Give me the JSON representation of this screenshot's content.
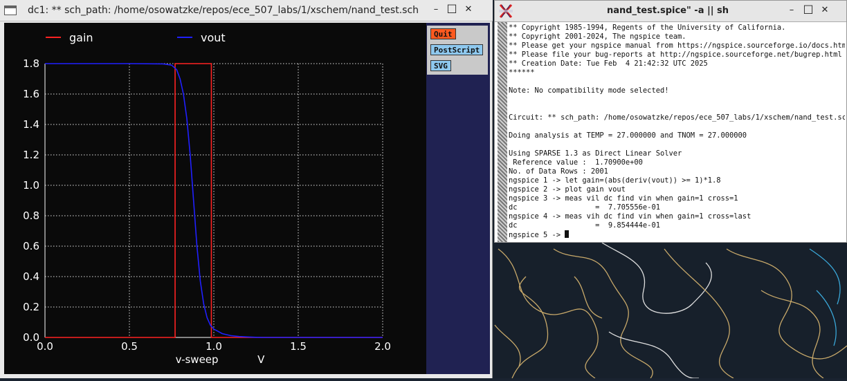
{
  "colors": {
    "gain": "#ff2222",
    "vout": "#2020ff",
    "plot_bg": "#0a0a0a",
    "grid": "#e0e0e0",
    "panel": "#202252",
    "quit": "#ff5a1f",
    "export_btn": "#8ec8ee"
  },
  "plot_window": {
    "title": "dc1: ** sch_path: /home/osowatzke/repos/ece_507_labs/1/xschem/nand_test.sch",
    "minimize_glyph": "–",
    "maximize_glyph": "□",
    "close_glyph": "✕",
    "buttons": {
      "quit": "Quit",
      "postscript": "PostScript",
      "svg": "SVG"
    }
  },
  "chart_data": {
    "type": "line",
    "xlabel": "v-sweep",
    "xunit": "V",
    "xlim": [
      0.0,
      2.0
    ],
    "ylim": [
      0.0,
      1.8
    ],
    "xticks": [
      0.0,
      0.5,
      1.0,
      1.5,
      2.0
    ],
    "xtick_labels": [
      "0.0",
      "0.5",
      "1.0",
      "1.5",
      "2.0"
    ],
    "yticks": [
      0.0,
      0.2,
      0.4,
      0.6,
      0.8,
      1.0,
      1.2,
      1.4,
      1.6,
      1.8
    ],
    "ytick_labels": [
      "0.0",
      "0.2",
      "0.4",
      "0.6",
      "0.8",
      "1.0",
      "1.2",
      "1.4",
      "1.6",
      "1.8"
    ],
    "grid": true,
    "legend_position": "top",
    "series": [
      {
        "name": "gain",
        "x": [
          0.0,
          0.7706,
          0.7706,
          0.9854,
          0.9854,
          2.0
        ],
        "values": [
          0.0,
          0.0,
          1.8,
          1.8,
          0.0,
          0.0
        ]
      },
      {
        "name": "vout",
        "x": [
          0.0,
          0.5,
          0.7,
          0.75,
          0.78,
          0.8,
          0.82,
          0.84,
          0.86,
          0.88,
          0.9,
          0.92,
          0.94,
          0.96,
          0.98,
          1.0,
          1.05,
          1.1,
          1.15,
          1.2,
          1.25,
          1.3,
          2.0
        ],
        "values": [
          1.8,
          1.8,
          1.798,
          1.79,
          1.76,
          1.7,
          1.6,
          1.44,
          1.2,
          0.9,
          0.6,
          0.37,
          0.22,
          0.13,
          0.08,
          0.055,
          0.025,
          0.012,
          0.006,
          0.003,
          0.001,
          0.0,
          0.0
        ]
      }
    ]
  },
  "terminal": {
    "title": "nand_test.spice\" -a || sh",
    "minimize_glyph": "–",
    "maximize_glyph": "□",
    "close_glyph": "✕",
    "lines": [
      "** Copyright 1985-1994, Regents of the University of California.",
      "** Copyright 2001-2024, The ngspice team.",
      "** Please get your ngspice manual from https://ngspice.sourceforge.io/docs.html",
      "** Please file your bug-reports at http://ngspice.sourceforge.net/bugrep.html",
      "** Creation Date: Tue Feb  4 21:42:32 UTC 2025",
      "******",
      "",
      "Note: No compatibility mode selected!",
      "",
      "",
      "Circuit: ** sch_path: /home/osowatzke/repos/ece_507_labs/1/xschem/nand_test.sch",
      "",
      "Doing analysis at TEMP = 27.000000 and TNOM = 27.000000",
      "",
      "Using SPARSE 1.3 as Direct Linear Solver",
      " Reference value :  1.70900e+00",
      "No. of Data Rows : 2001",
      "ngspice 1 -> let gain=(abs(deriv(vout)) >= 1)*1.8",
      "ngspice 2 -> plot gain vout",
      "ngspice 3 -> meas vil dc find vin when gain=1 cross=1",
      "dc                  =  7.705556e-01",
      "ngspice 4 -> meas vih dc find vin when gain=1 cross=last",
      "dc                  =  9.854444e-01"
    ],
    "prompt": "ngspice 5 -> "
  }
}
